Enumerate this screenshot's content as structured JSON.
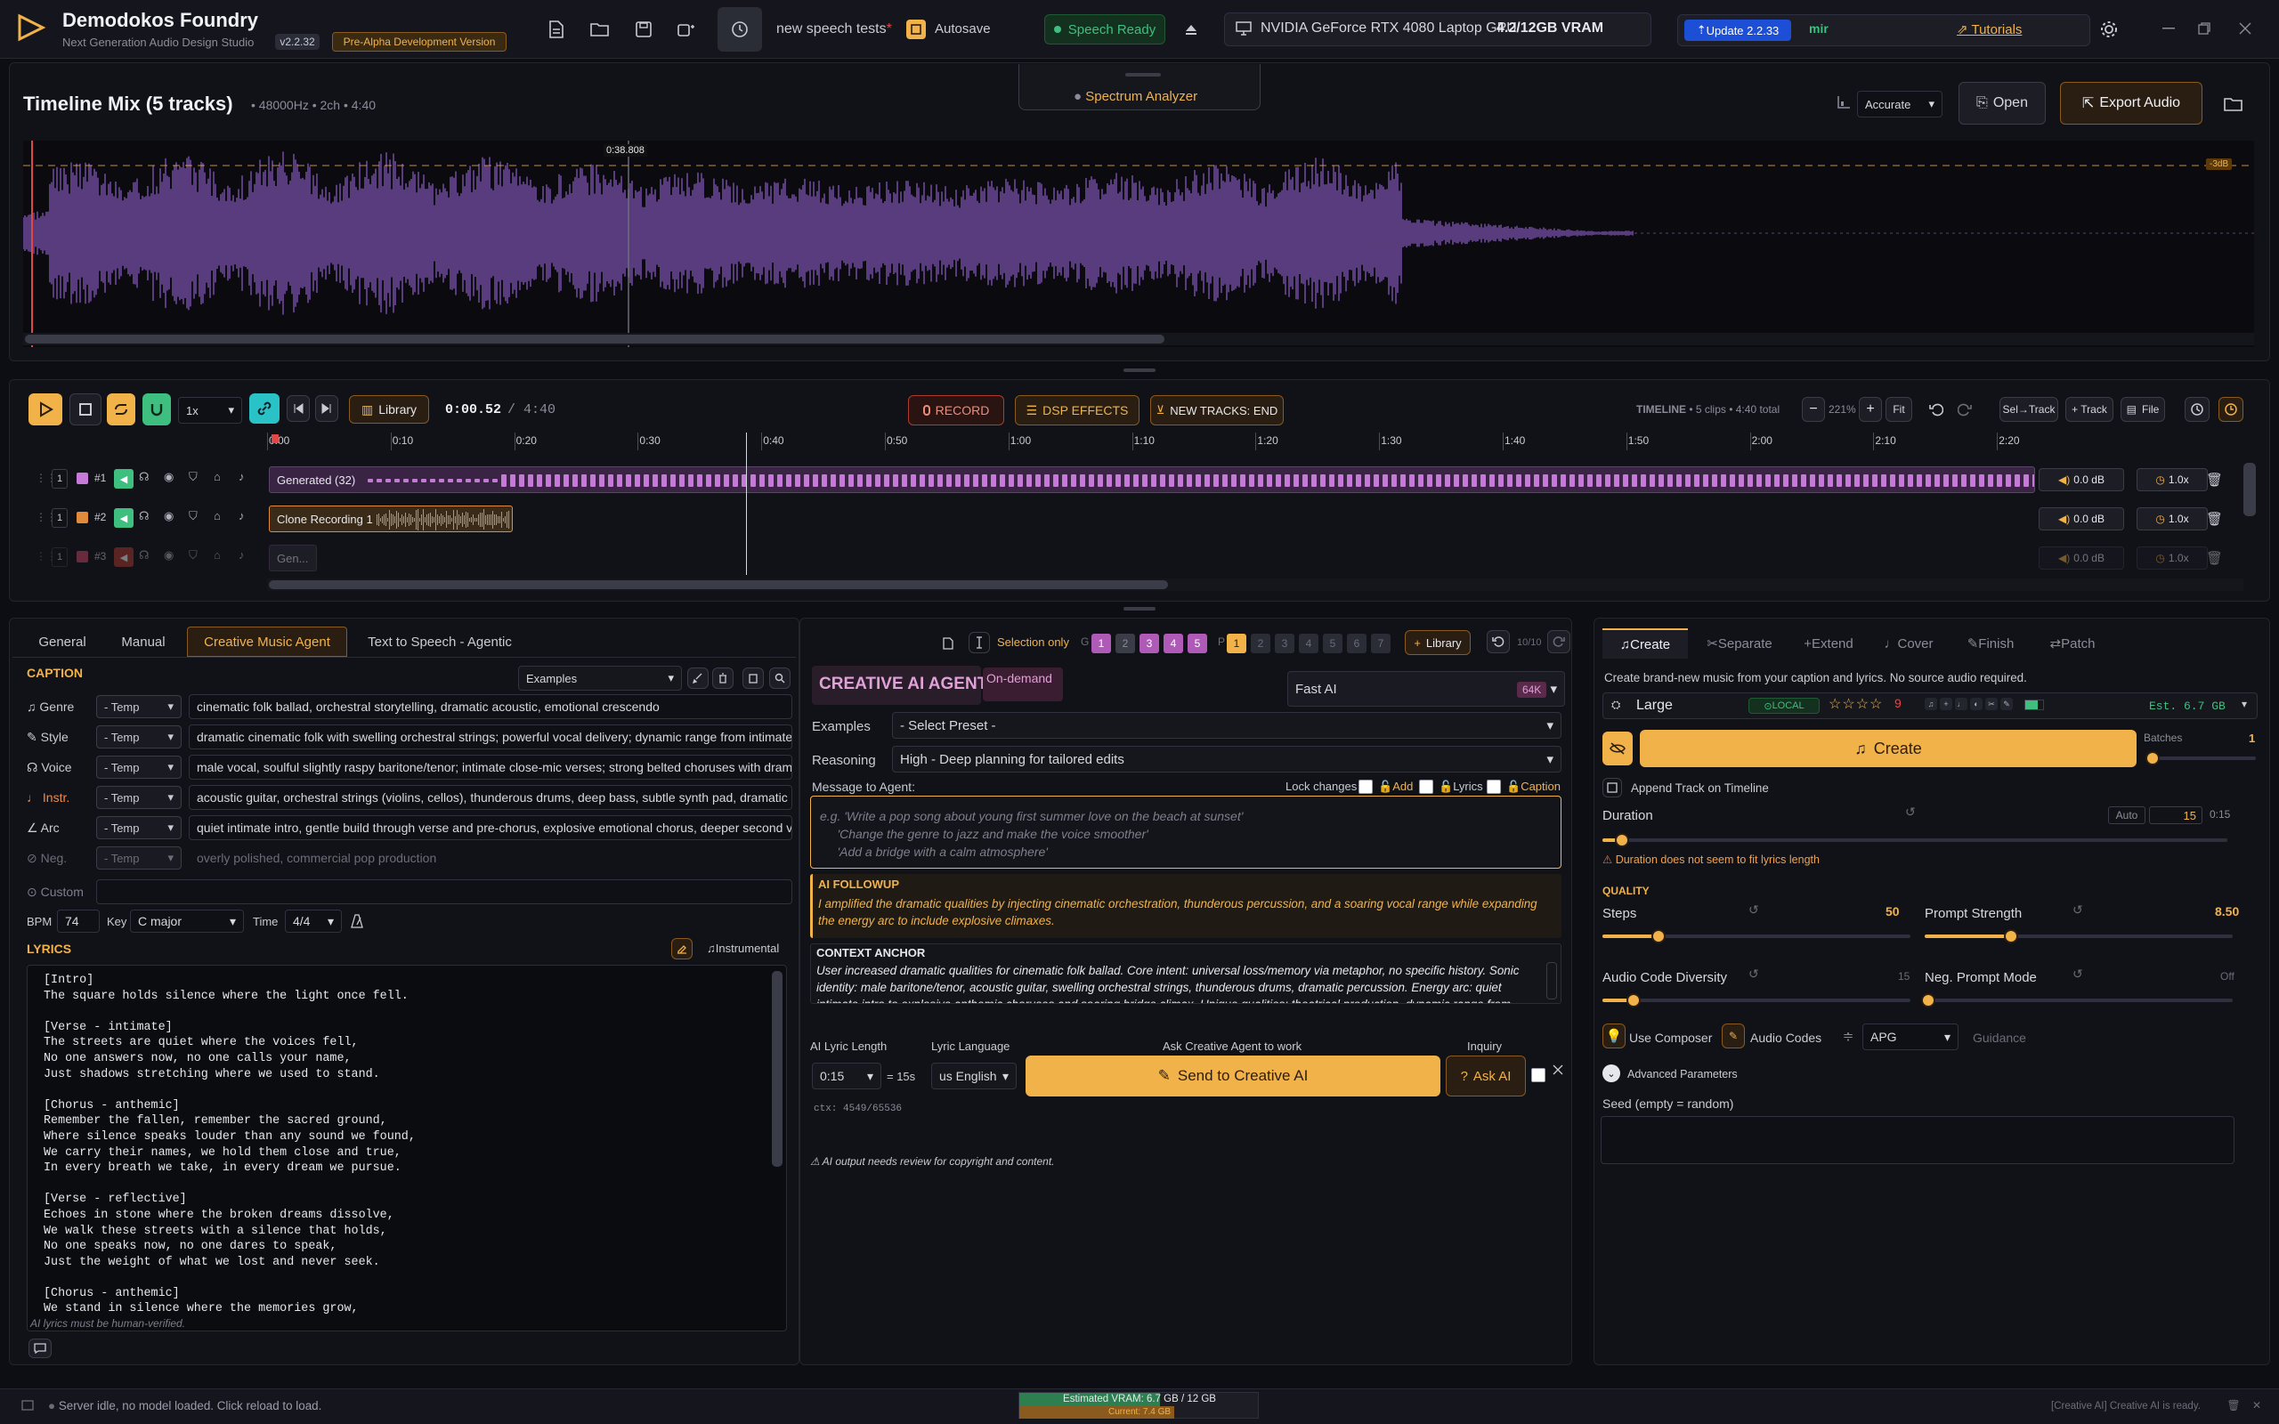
{
  "app": {
    "title": "Demodokos Foundry",
    "subtitle": "Next Generation Audio Design Studio",
    "version": "v2.2.32",
    "release": "Pre-Alpha Development Version"
  },
  "topbar": {
    "project_name": "new speech tests",
    "project_modified_mark": "*",
    "autosave": "Autosave",
    "speech_status": "Speech Ready",
    "gpu": "NVIDIA GeForce RTX 4080 Laptop GPU",
    "vram": "4.2/12GB VRAM",
    "update": "Update 2.2.33",
    "user": "mir",
    "tutorials": "Tutorials"
  },
  "timeline_mix": {
    "title": "Timeline Mix (5 tracks)",
    "meta": "• 48000Hz • 2ch • 4:40",
    "spectrum": "Spectrum Analyzer",
    "quality": "Accurate",
    "open": "Open",
    "export": "Export Audio",
    "playhead_time": "0:38.808",
    "db_marker": "-3dB"
  },
  "transport": {
    "speed": "1x",
    "library": "Library",
    "time_current": "0:00.52",
    "time_total": "/ 4:40",
    "record": "RECORD",
    "dsp": "DSP EFFECTS",
    "new_tracks": "NEW TRACKS: END",
    "timeline_label": "TIMELINE",
    "timeline_info": "• 5 clips • 4:40 total",
    "zoom": "221%",
    "fit": "Fit",
    "sel_track": "Sel→Track",
    "add_track": "+ Track",
    "file": "File",
    "ruler": [
      "0:00",
      "0:10",
      "0:20",
      "0:30",
      "0:40",
      "0:50",
      "1:00",
      "1:10",
      "1:20",
      "1:30",
      "1:40",
      "1:50",
      "2:00",
      "2:10",
      "2:20"
    ],
    "tracks": [
      {
        "num": "#1",
        "clip": "Generated (32)",
        "gain": "0.0 dB",
        "speed": "1.0x",
        "color": "#c47ad6"
      },
      {
        "num": "#2",
        "clip": "Clone Recording 1",
        "gain": "0.0 dB",
        "speed": "1.0x",
        "color": "#e08a3a"
      },
      {
        "num": "#3",
        "clip": "Gen...",
        "gain": "0.0 dB",
        "speed": "1.0x",
        "color": "#d04a6a"
      }
    ]
  },
  "left": {
    "tabs": [
      "General",
      "Manual",
      "Creative Music Agent",
      "Text to Speech - Agentic"
    ],
    "caption_header": "CAPTION",
    "examples": "Examples",
    "rows": [
      {
        "label": "Genre",
        "temp": "- Temp",
        "value": "cinematic folk ballad, orchestral storytelling, dramatic acoustic, emotional crescendo"
      },
      {
        "label": "Style",
        "temp": "- Temp",
        "value": "dramatic cinematic folk with swelling orchestral strings; powerful vocal delivery; dynamic range from intimate"
      },
      {
        "label": "Voice",
        "temp": "- Temp",
        "value": "male vocal, soulful slightly raspy baritone/tenor; intimate close-mic verses; strong belted choruses with dram"
      },
      {
        "label": "Instr.",
        "temp": "- Temp",
        "value": "acoustic guitar, orchestral strings (violins, cellos), thunderous drums, deep bass, subtle synth pad, dramatic pe"
      },
      {
        "label": "Arc",
        "temp": "- Temp",
        "value": "quiet intimate intro, gentle build through verse and pre-chorus, explosive emotional chorus, deeper second v"
      },
      {
        "label": "Neg.",
        "temp": "- Temp",
        "value": "overly polished, commercial pop production"
      }
    ],
    "custom": "Custom",
    "bpm_label": "BPM",
    "bpm": "74",
    "key_label": "Key",
    "key": "C major",
    "time_label": "Time",
    "time": "4/4",
    "lyrics_header": "LYRICS",
    "instrumental": "Instrumental",
    "lyrics": "[Intro]\nThe square holds silence where the light once fell.\n\n[Verse - intimate]\nThe streets are quiet where the voices fell,\nNo one answers now, no one calls your name,\nJust shadows stretching where we used to stand.\n\n[Chorus - anthemic]\nRemember the fallen, remember the sacred ground,\nWhere silence speaks louder than any sound we found,\nWe carry their names, we hold them close and true,\nIn every breath we take, in every dream we pursue.\n\n[Verse - reflective]\nEchoes in stone where the broken dreams dissolve,\nWe walk these streets with a silence that holds,\nNo one speaks now, no one dares to speak,\nJust the weight of what we lost and never seek.\n\n[Chorus - anthemic]\nWe stand in silence where the memories grow,",
    "lyrics_note": "AI lyrics must be human-verified."
  },
  "middle": {
    "selection_only": "Selection only",
    "library": "Library",
    "history": "10/10",
    "agent_title": "CREATIVE AI AGENT",
    "on_demand": "On-demand",
    "model": "Fast AI",
    "ctx_badge": "64K",
    "examples_label": "Examples",
    "examples_value": "- Select Preset -",
    "reasoning_label": "Reasoning",
    "reasoning_value": "High - Deep planning for tailored edits",
    "message_label": "Message to Agent:",
    "lock_changes": "Lock changes",
    "lock_add": "Add",
    "lock_lyrics": "Lyrics",
    "lock_caption": "Caption",
    "placeholder": "e.g. 'Write a pop song about young first summer love on the beach at sunset'\n     'Change the genre to jazz and make the voice smoother'\n     'Add a bridge with a calm atmosphere'",
    "followup_title": "AI FOLLOWUP",
    "followup_text": "I amplified the dramatic qualities by injecting cinematic orchestration, thunderous percussion, and a soaring vocal range while expanding the energy arc to include explosive climaxes.",
    "anchor_title": "CONTEXT ANCHOR",
    "anchor_text": "User increased dramatic qualities for cinematic folk ballad. Core intent: universal loss/memory via metaphor, no specific history. Sonic identity: male baritone/tenor, acoustic guitar, swelling orchestral strings, thunderous drums, dramatic percussion. Energy arc: quiet intimate intro to explosive anthemic choruses and soaring bridge climax. Unique qualities: theatrical production, dynamic range from close-mic verses to belted highs, emotional gravity through silence themes.",
    "lyric_length_label": "AI Lyric Length",
    "lyric_length": "0:15",
    "lyric_length_eq": "= 15s",
    "lyric_lang_label": "Lyric Language",
    "lyric_lang": "us English",
    "ask_label": "Ask Creative Agent to work",
    "send": "Send to Creative AI",
    "inquiry_label": "Inquiry",
    "ask_ai": "Ask AI",
    "ctx": "ctx: 4549/65536",
    "disclaimer": "AI output needs review for copyright and content."
  },
  "right": {
    "tabs": [
      "Create",
      "Separate",
      "Extend",
      "Cover",
      "Finish",
      "Patch"
    ],
    "desc": "Create brand-new music from your caption and lyrics. No source audio required.",
    "model": "Large",
    "local": "LOCAL",
    "est": "Est. 6.7 GB",
    "create": "Create",
    "batches_label": "Batches",
    "batches": "1",
    "append": "Append Track on Timeline",
    "duration_label": "Duration",
    "duration_auto": "Auto",
    "duration_value": "15",
    "duration_time": "0:15",
    "duration_warning": "Duration does not seem to fit lyrics length",
    "quality_header": "QUALITY",
    "steps_label": "Steps",
    "steps": "50",
    "prompt_strength_label": "Prompt Strength",
    "prompt_strength": "8.50",
    "diversity_label": "Audio Code Diversity",
    "diversity": "15",
    "neg_mode_label": "Neg. Prompt Mode",
    "neg_mode": "Off",
    "use_composer": "Use Composer",
    "audio_codes": "Audio Codes",
    "guidance_method": "APG",
    "guidance": "Guidance",
    "advanced": "Advanced Parameters",
    "seed_label": "Seed (empty = random)",
    "seed": ""
  },
  "status": {
    "server": "Server idle, no model loaded. Click reload to load.",
    "vram_est": "Estimated VRAM: 6.7 GB / 12 GB",
    "vram_current": "Current: 7.4 GB",
    "right_msg": "[Creative AI] Creative AI is ready."
  },
  "colors": {
    "accent": "#f2b24a",
    "purple": "#9b6fd6",
    "green": "#3fbf7f",
    "bg": "#0d0e13"
  }
}
